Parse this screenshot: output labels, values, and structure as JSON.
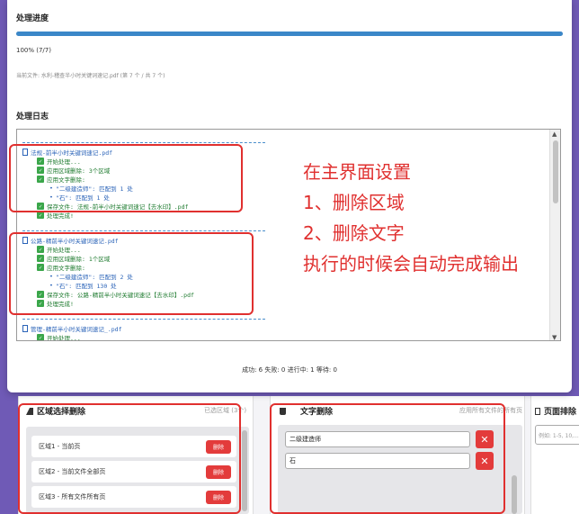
{
  "modal": {
    "progress_title": "处理进度",
    "progress_value": 1.0,
    "progress_text": "100% (7/7)",
    "current_file": "当前文件: 水利-稽查半小时关键词速记.pdf (第 7 个 / 共 7 个)",
    "log_title": "处理日志",
    "status": "成功: 6 失败: 0 进行中: 1 等待: 0"
  },
  "log": {
    "block1": {
      "file": "法规-前半小时关键词速记.pdf",
      "lines": [
        "开始处理...",
        "应用区域删除: 3个区域",
        "应用文字删除:"
      ],
      "subs": [
        "\"二级建造师\": 匹配到 1 处",
        "\"石\": 匹配到 1 处"
      ],
      "end": [
        "保存文件: 法规-前半小时关键词速记【去水印】.pdf",
        "处理完成!"
      ]
    },
    "block2": {
      "file": "公路-精前半小时关键词速记.pdf",
      "lines": [
        "开始处理...",
        "应用区域删除: 1个区域",
        "应用文字删除:"
      ],
      "subs": [
        "\"二级建造师\": 匹配到 2 处",
        "\"石\": 匹配到 130 处"
      ],
      "end": [
        "保存文件: 公路-精前半小时关键词速记【去水印】.pdf",
        "处理完成!"
      ]
    },
    "block3": {
      "file": "管理-精前半小时关键词速记_.pdf",
      "lines": [
        "开始处理..."
      ]
    }
  },
  "annotation": {
    "line1": "在主界面设置",
    "line2": "1、删除区域",
    "line3": "2、删除文字",
    "line4": "执行的时候会自动完成输出"
  },
  "area_panel": {
    "title": "区域选择删除",
    "subtitle": "已选区域 (3个)",
    "items": [
      {
        "label": "区域1 - 当前页",
        "button": "删除"
      },
      {
        "label": "区域2 - 当前文件全部页",
        "button": "删除"
      },
      {
        "label": "区域3 - 所有文件所有页",
        "button": "删除"
      }
    ]
  },
  "text_panel": {
    "title": "文字删除",
    "subtitle": "应用所有文件的所有页",
    "inputs": [
      "二级建造师",
      "石"
    ],
    "remove_icon": "✕"
  },
  "page_panel": {
    "title": "页面排除",
    "placeholder": "例如: 1-5, 10,..."
  },
  "colors": {
    "accent": "#3b87c8",
    "danger": "#e33b3b",
    "annotation": "#e0302f",
    "log_green": "#1d7a2e",
    "log_blue": "#2a63b8",
    "background": "#6f5ab6"
  }
}
